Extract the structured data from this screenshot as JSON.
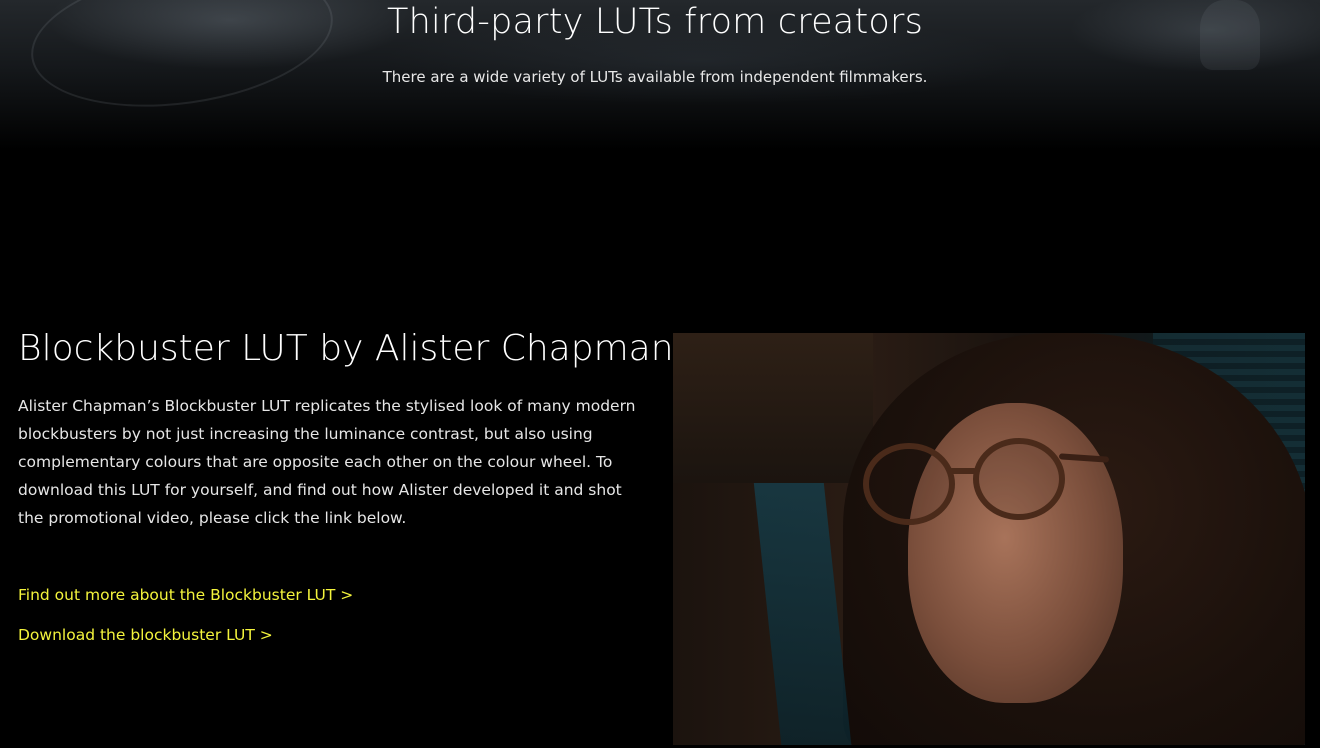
{
  "hero": {
    "title": "Third-party LUTs from creators",
    "subtitle": "There are a wide variety of LUTs available from independent filmmakers."
  },
  "feature": {
    "title": "Blockbuster LUT by Alister Chapman",
    "description": "Alister Chapman’s Blockbuster LUT replicates the stylised look of many modern blockbusters by not just increasing the luminance contrast, but also using complementary colours that are opposite each other on the colour wheel. To download this LUT for yourself, and find out how Alister developed it and shot the promotional video, please click the link below.",
    "links": [
      {
        "label": "Find out more about the Blockbuster LUT >"
      },
      {
        "label": "Download the blockbuster LUT >"
      }
    ]
  },
  "colors": {
    "background": "#000000",
    "link": "#f4f43c",
    "text": "#ffffff"
  }
}
